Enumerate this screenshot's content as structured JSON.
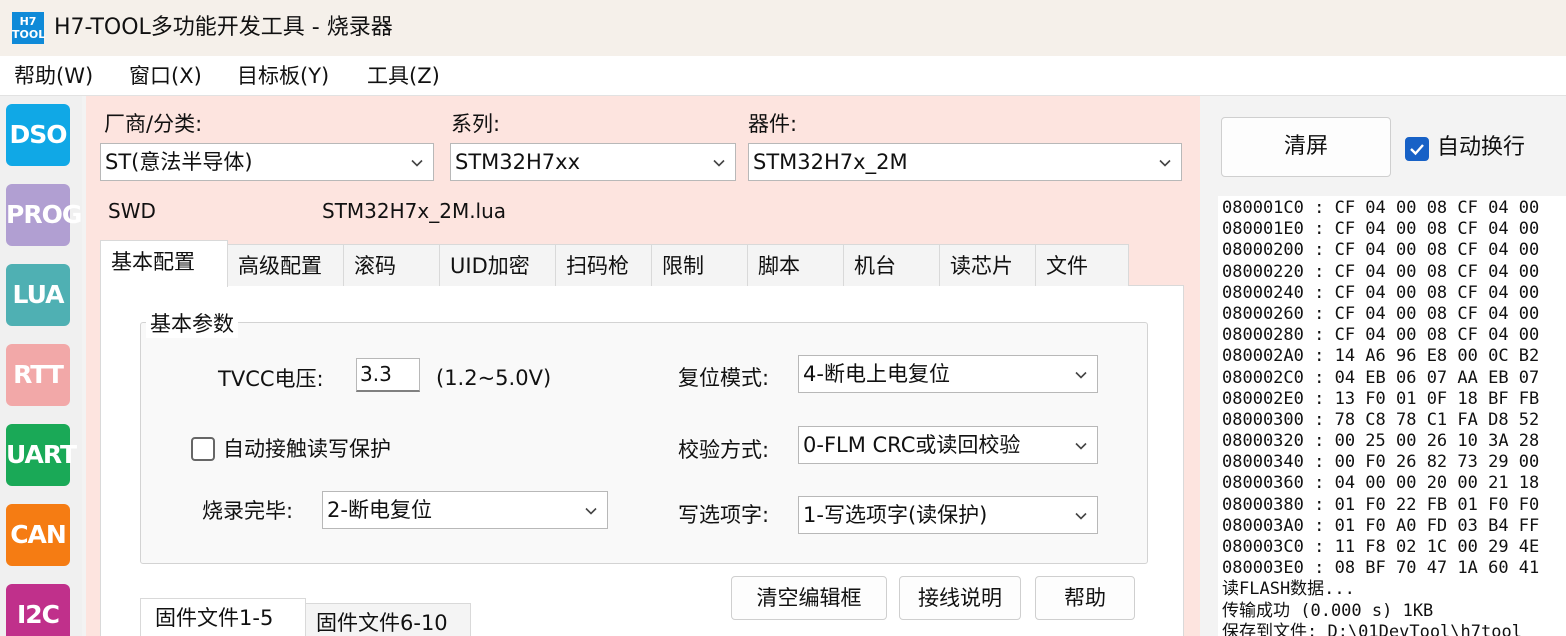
{
  "window": {
    "logo_line1": "H7",
    "logo_line2": "TOOL",
    "title": "H7-TOOL多功能开发工具 - 烧录器"
  },
  "menu": {
    "items": [
      "帮助(W)",
      "窗口(X)",
      "目标板(Y)",
      "工具(Z)"
    ]
  },
  "toolbar": {
    "buttons": [
      {
        "label": "DSO",
        "color": "#10a8e6"
      },
      {
        "label": "PROG",
        "color": "#b19fd2"
      },
      {
        "label": "LUA",
        "color": "#4fb0b3"
      },
      {
        "label": "RTT",
        "color": "#f2a8a8"
      },
      {
        "label": "UART",
        "color": "#1aa957"
      },
      {
        "label": "CAN",
        "color": "#f57c13"
      },
      {
        "label": "I2C",
        "color": "#c0308b"
      }
    ]
  },
  "device": {
    "vendor_label": "厂商/分类:",
    "vendor_value": "ST(意法半导体)",
    "series_label": "系列:",
    "series_value": "STM32H7xx",
    "part_label": "器件:",
    "part_value": "STM32H7x_2M",
    "interface": "SWD",
    "script_file": "STM32H7x_2M.lua"
  },
  "tabs": [
    "基本配置",
    "高级配置",
    "滚码",
    "UID加密",
    "扫码枪",
    "限制",
    "脚本",
    "机台",
    "读芯片",
    "文件"
  ],
  "basic": {
    "group_title": "基本参数",
    "tvcc_label": "TVCC电压:",
    "tvcc_value": "3.3",
    "tvcc_range": "(1.2~5.0V)",
    "auto_protect_label": "自动接触读写保护",
    "auto_protect_checked": false,
    "burn_done_label": "烧录完毕:",
    "burn_done_value": "2-断电复位",
    "reset_mode_label": "复位模式:",
    "reset_mode_value": "4-断电上电复位",
    "verify_label": "校验方式:",
    "verify_value": "0-FLM CRC或读回校验",
    "option_label": "写选项字:",
    "option_value": "1-写选项字(读保护)"
  },
  "actions": {
    "clear_editor": "清空编辑框",
    "wiring_help": "接线说明",
    "help": "帮助"
  },
  "firmware_tabs": [
    "固件文件1-5",
    "固件文件6-10"
  ],
  "log": {
    "clear_label": "清屏",
    "wrap_label": "自动换行",
    "wrap_checked": true,
    "lines": [
      "080001C0 : CF 04 00 08 CF 04 00",
      "080001E0 : CF 04 00 08 CF 04 00",
      "08000200 : CF 04 00 08 CF 04 00",
      "08000220 : CF 04 00 08 CF 04 00",
      "08000240 : CF 04 00 08 CF 04 00",
      "08000260 : CF 04 00 08 CF 04 00",
      "08000280 : CF 04 00 08 CF 04 00",
      "080002A0 : 14 A6 96 E8 00 0C B2",
      "080002C0 : 04 EB 06 07 AA EB 07",
      "080002E0 : 13 F0 01 0F 18 BF FB",
      "08000300 : 78 C8 78 C1 FA D8 52",
      "08000320 : 00 25 00 26 10 3A 28",
      "08000340 : 00 F0 26 82 73 29 00",
      "08000360 : 04 00 00 20 00 21 18",
      "08000380 : 01 F0 22 FB 01 F0 F0",
      "080003A0 : 01 F0 A0 FD 03 B4 FF",
      "080003C0 : 11 F8 02 1C 00 29 4E",
      "080003E0 : 08 BF 70 47 1A 60 41",
      "读FLASH数据...",
      "传输成功 (0.000 s) 1KB",
      "保存到文件: D:\\01DevTool\\h7tool"
    ]
  }
}
